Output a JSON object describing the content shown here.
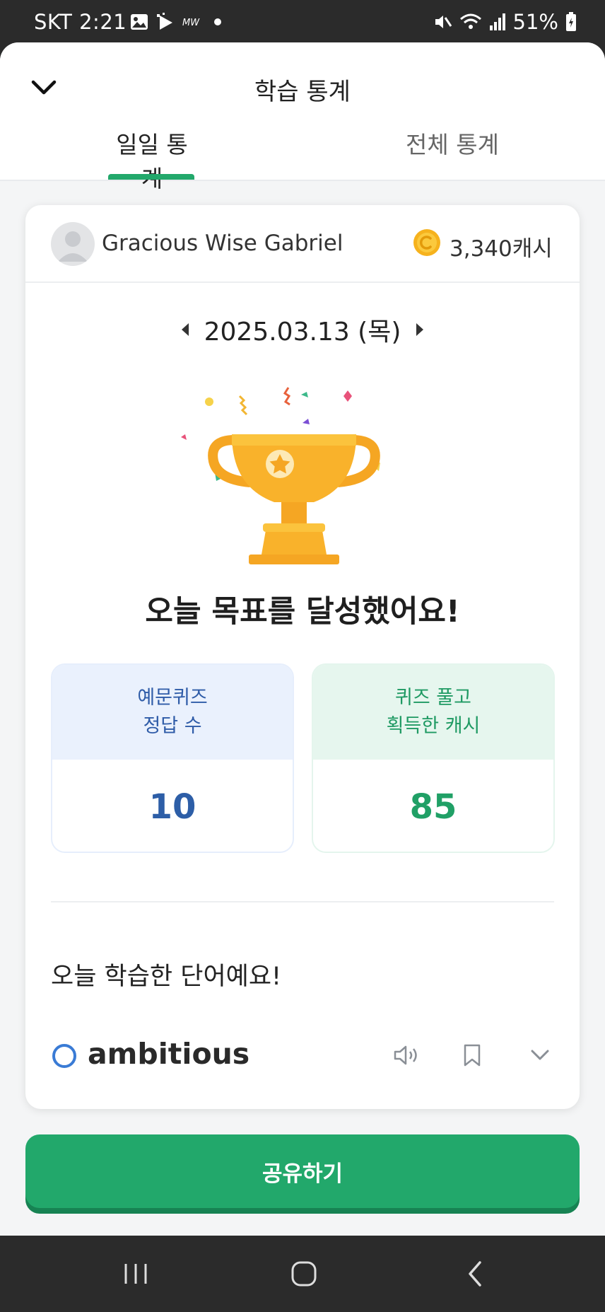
{
  "status_bar": {
    "carrier_time": "SKT 2:21",
    "battery": "51%",
    "icons": [
      "gallery-icon",
      "play-icon",
      "mw-icon",
      "dot-icon",
      "mute-icon",
      "wifi-icon",
      "signal-icon",
      "battery-icon"
    ]
  },
  "header": {
    "title": "학습 통계",
    "back_icon": "chevron-down-icon",
    "tabs": [
      {
        "label": "일일 통계",
        "active": true
      },
      {
        "label": "전체 통계",
        "active": false
      }
    ]
  },
  "profile": {
    "username": "Gracious Wise Gabriel",
    "cash": "3,340캐시"
  },
  "date": {
    "label": "2025.03.13 (목)"
  },
  "achievement": {
    "message": "오늘 목표를 달성했어요!"
  },
  "stats": [
    {
      "label_line1": "예문퀴즈",
      "label_line2": "정답 수",
      "value": "10"
    },
    {
      "label_line1": "퀴즈 풀고",
      "label_line2": "획득한 캐시",
      "value": "85"
    }
  ],
  "words": {
    "heading": "오늘 학습한 단어예요!",
    "items": [
      {
        "word": "ambitious"
      }
    ]
  },
  "share_button": {
    "label": "공유하기"
  },
  "colors": {
    "accent_green": "#22a86b",
    "stat_blue": "#2d5ea7",
    "stat_green": "#20a066",
    "trophy_orange": "#f7a820"
  }
}
